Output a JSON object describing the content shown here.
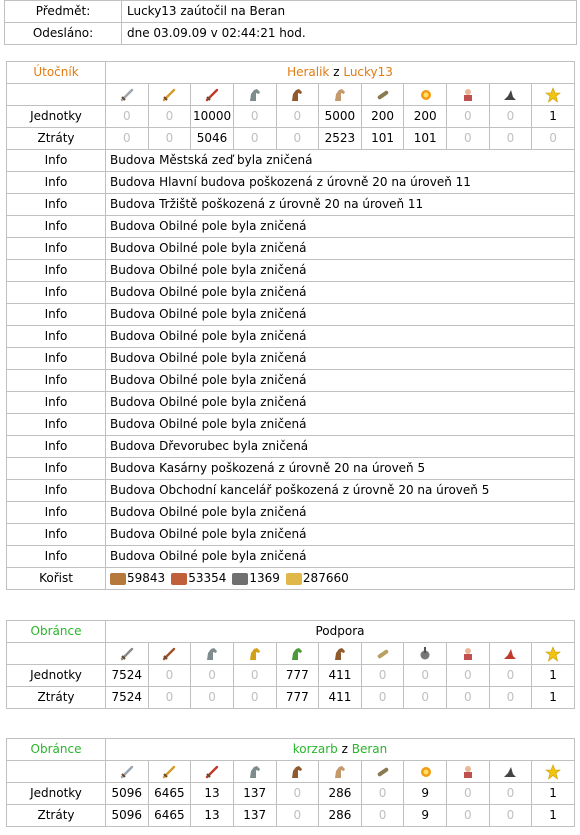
{
  "header": {
    "subject_label": "Předmět:",
    "subject_value": "Lucky13 zaútočil na Beran",
    "sent_label": "Odesláno:",
    "sent_value": "dne 03.09.09 v 02:44:21 hod."
  },
  "attacker": {
    "role": "Útočník",
    "player": "Heralik",
    "joiner": "z",
    "village": "Lucky13",
    "unit_icons": [
      "sword-icon",
      "axe-icon",
      "dagger-icon",
      "horse-gray-icon",
      "horse-brown-icon",
      "horse-beige-icon",
      "ram-icon",
      "fireball-icon",
      "chief-icon",
      "hat-icon",
      "star-icon"
    ],
    "units_label": "Jednotky",
    "units": [
      "0",
      "0",
      "10000",
      "0",
      "0",
      "5000",
      "200",
      "200",
      "0",
      "0",
      "1"
    ],
    "losses_label": "Ztráty",
    "losses": [
      "0",
      "0",
      "5046",
      "0",
      "0",
      "2523",
      "101",
      "101",
      "0",
      "0",
      "0"
    ],
    "info_label": "Info",
    "info": [
      "Budova Městská zeď byla zničená",
      "Budova Hlavní budova poškozená z úrovně 20 na úroveň 11",
      "Budova Tržiště poškozená z úrovně 20 na úroveň 11",
      "Budova Obilné pole byla zničená",
      "Budova Obilné pole byla zničená",
      "Budova Obilné pole byla zničená",
      "Budova Obilné pole byla zničená",
      "Budova Obilné pole byla zničená",
      "Budova Obilné pole byla zničená",
      "Budova Obilné pole byla zničená",
      "Budova Obilné pole byla zničená",
      "Budova Obilné pole byla zničená",
      "Budova Obilné pole byla zničená",
      "Budova Dřevorubec byla zničená",
      "Budova Kasárny poškozená z úrovně 20 na úroveň 5",
      "Budova Obchodní kancelář poškozená z úrovně 20 na úroveň 5",
      "Budova Obilné pole byla zničená",
      "Budova Obilné pole byla zničená",
      "Budova Obilné pole byla zničená"
    ],
    "loot_label": "Kořist",
    "loot": [
      {
        "icon": "wood-icon",
        "value": "59843",
        "color": "#b5793c"
      },
      {
        "icon": "clay-icon",
        "value": "53354",
        "color": "#c0603a"
      },
      {
        "icon": "iron-icon",
        "value": "1369",
        "color": "#707070"
      },
      {
        "icon": "crop-icon",
        "value": "287660",
        "color": "#e0b84a"
      }
    ]
  },
  "defender1": {
    "role": "Obránce",
    "title": "Podpora",
    "unit_icons": [
      "mace-icon",
      "spear-icon",
      "horse-gray-icon",
      "horse-yellow-icon",
      "horse-green-icon",
      "horse-brown-icon",
      "cannon-icon",
      "catapult-icon",
      "chief-icon",
      "hat-red-icon",
      "star-icon"
    ],
    "units_label": "Jednotky",
    "units": [
      "7524",
      "0",
      "0",
      "0",
      "777",
      "411",
      "0",
      "0",
      "0",
      "0",
      "1"
    ],
    "losses_label": "Ztráty",
    "losses": [
      "7524",
      "0",
      "0",
      "0",
      "777",
      "411",
      "0",
      "0",
      "0",
      "0",
      "1"
    ]
  },
  "defender2": {
    "role": "Obránce",
    "player": "korzarb",
    "joiner": "z",
    "village": "Beran",
    "unit_icons": [
      "sword-icon",
      "axe-icon",
      "dagger-icon",
      "horse-gray-icon",
      "horse-brown-icon",
      "horse-beige-icon",
      "ram-icon",
      "fireball-icon",
      "chief-icon",
      "hat-icon",
      "star-icon"
    ],
    "units_label": "Jednotky",
    "units": [
      "5096",
      "6465",
      "13",
      "137",
      "0",
      "286",
      "0",
      "9",
      "0",
      "0",
      "1"
    ],
    "losses_label": "Ztráty",
    "losses": [
      "5096",
      "6465",
      "13",
      "137",
      "0",
      "286",
      "0",
      "9",
      "0",
      "0",
      "1"
    ]
  },
  "icon_colors": {
    "sword-icon": "#9aa5b0",
    "axe-icon": "#d89a2a",
    "dagger-icon": "#c0392b",
    "horse-gray-icon": "#7f8c8d",
    "horse-brown-icon": "#8e5a2e",
    "horse-beige-icon": "#c49a6c",
    "ram-icon": "#8a7a50",
    "fireball-icon": "#f39c12",
    "chief-icon": "#c0504d",
    "hat-icon": "#444444",
    "star-icon": "#f1c40f",
    "mace-icon": "#8a8a8a",
    "spear-icon": "#a0522d",
    "horse-yellow-icon": "#d4a017",
    "horse-green-icon": "#4a9a3a",
    "cannon-icon": "#b8a060",
    "catapult-icon": "#777777",
    "hat-red-icon": "#c0392b"
  }
}
